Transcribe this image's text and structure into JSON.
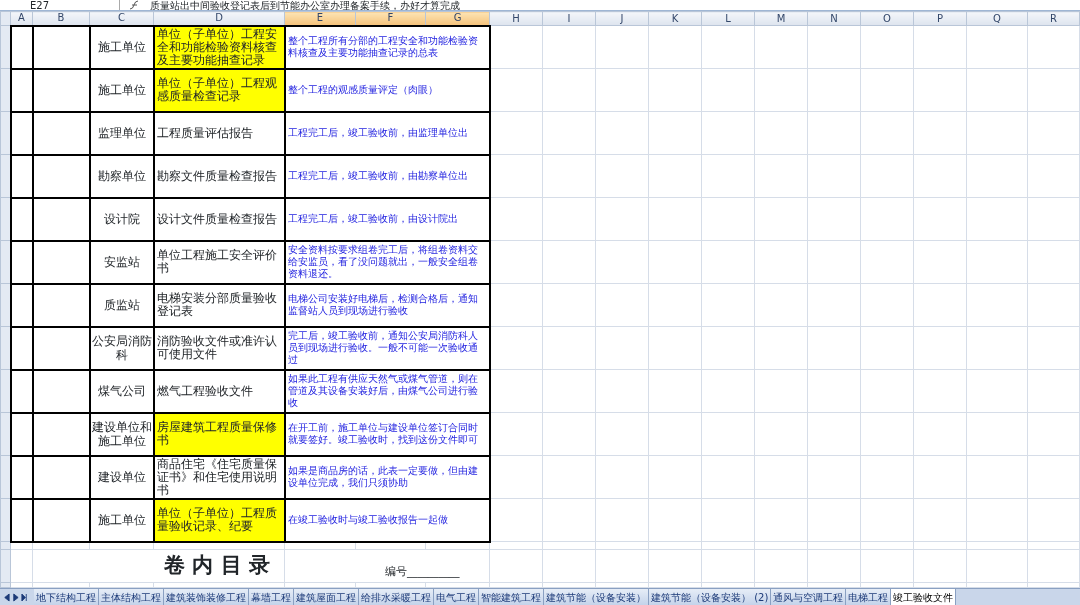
{
  "name_box": "E27",
  "formula": "质量站出中间验收登记表后到节能办公室办理备案手续，办好才算完成",
  "columns": [
    {
      "label": "A",
      "selected": false
    },
    {
      "label": "B",
      "selected": false
    },
    {
      "label": "C",
      "selected": false
    },
    {
      "label": "D",
      "selected": false
    },
    {
      "label": "E",
      "selected": true
    },
    {
      "label": "F",
      "selected": true
    },
    {
      "label": "G",
      "selected": true
    },
    {
      "label": "H",
      "selected": false
    },
    {
      "label": "I",
      "selected": false
    },
    {
      "label": "J",
      "selected": false
    },
    {
      "label": "K",
      "selected": false
    },
    {
      "label": "L",
      "selected": false
    },
    {
      "label": "M",
      "selected": false
    },
    {
      "label": "N",
      "selected": false
    },
    {
      "label": "O",
      "selected": false
    },
    {
      "label": "P",
      "selected": false
    },
    {
      "label": "Q",
      "selected": false
    },
    {
      "label": "R",
      "selected": false
    }
  ],
  "rows": [
    {
      "unit": "施工单位",
      "document": "单位（子单位）工程安全和功能检验资料核查及主要功能抽查记录",
      "highlight": true,
      "note": "整个工程所有分部的工程安全和功能检验资料核查及主要功能抽查记录的总表"
    },
    {
      "unit": "施工单位",
      "document": "单位（子单位）工程观感质量检查记录",
      "highlight": true,
      "note": "整个工程的观感质量评定（肉眼）"
    },
    {
      "unit": "监理单位",
      "document": "工程质量评估报告",
      "highlight": false,
      "note": "工程完工后，竣工验收前，由监理单位出"
    },
    {
      "unit": "勘察单位",
      "document": "勘察文件质量检查报告",
      "highlight": false,
      "note": "工程完工后，竣工验收前，由勘察单位出"
    },
    {
      "unit": "设计院",
      "document": "设计文件质量检查报告",
      "highlight": false,
      "note": "工程完工后，竣工验收前，由设计院出"
    },
    {
      "unit": "安监站",
      "document": "单位工程施工安全评价书",
      "highlight": false,
      "note": "安全资料按要求组卷完工后，将组卷资料交给安监员，看了没问题就出，一般安全组卷资料退还。"
    },
    {
      "unit": "质监站",
      "document": "电梯安装分部质量验收登记表",
      "highlight": false,
      "note": "电梯公司安装好电梯后，检测合格后，通知监督站人员到现场进行验收"
    },
    {
      "unit": "公安局消防科",
      "document": "消防验收文件或准许认可使用文件",
      "highlight": false,
      "note": "完工后，竣工验收前，通知公安局消防科人员到现场进行验收。一般不可能一次验收通过"
    },
    {
      "unit": "煤气公司",
      "document": "燃气工程验收文件",
      "highlight": false,
      "note": "如果此工程有供应天然气或煤气管道，则在管道及其设备安装好后，由煤气公司进行验收"
    },
    {
      "unit": "建设单位和施工单位",
      "document": "房屋建筑工程质量保修书",
      "highlight": true,
      "note": "在开工前，施工单位与建设单位签订合同时就要签好。竣工验收时，找到这份文件即可"
    },
    {
      "unit": "建设单位",
      "document": "商品住宅《住宅质量保证书》和住宅使用说明书",
      "highlight": false,
      "note": "如果是商品房的话，此表一定要做，但由建设单位完成，我们只须协助"
    },
    {
      "unit": "施工单位",
      "document": "单位（子单位）工程质量验收记录、纪要",
      "highlight": true,
      "note": "在竣工验收时与竣工验收报告一起做"
    }
  ],
  "title": "卷 内 目 录",
  "number_label": "编号__________",
  "sheet_tabs": [
    {
      "label": "地下结构工程",
      "selected": false
    },
    {
      "label": "主体结构工程",
      "selected": false
    },
    {
      "label": "建筑装饰装修工程",
      "selected": false
    },
    {
      "label": "幕墙工程",
      "selected": false
    },
    {
      "label": "建筑屋面工程",
      "selected": false
    },
    {
      "label": "给排水采暖工程",
      "selected": false
    },
    {
      "label": "电气工程",
      "selected": false
    },
    {
      "label": "智能建筑工程",
      "selected": false
    },
    {
      "label": "建筑节能（设备安装）",
      "selected": false
    },
    {
      "label": "建筑节能（设备安装） (2)",
      "selected": false
    },
    {
      "label": "通风与空调工程",
      "selected": false
    },
    {
      "label": "电梯工程",
      "selected": false
    },
    {
      "label": "竣工验收文件",
      "selected": true
    }
  ]
}
